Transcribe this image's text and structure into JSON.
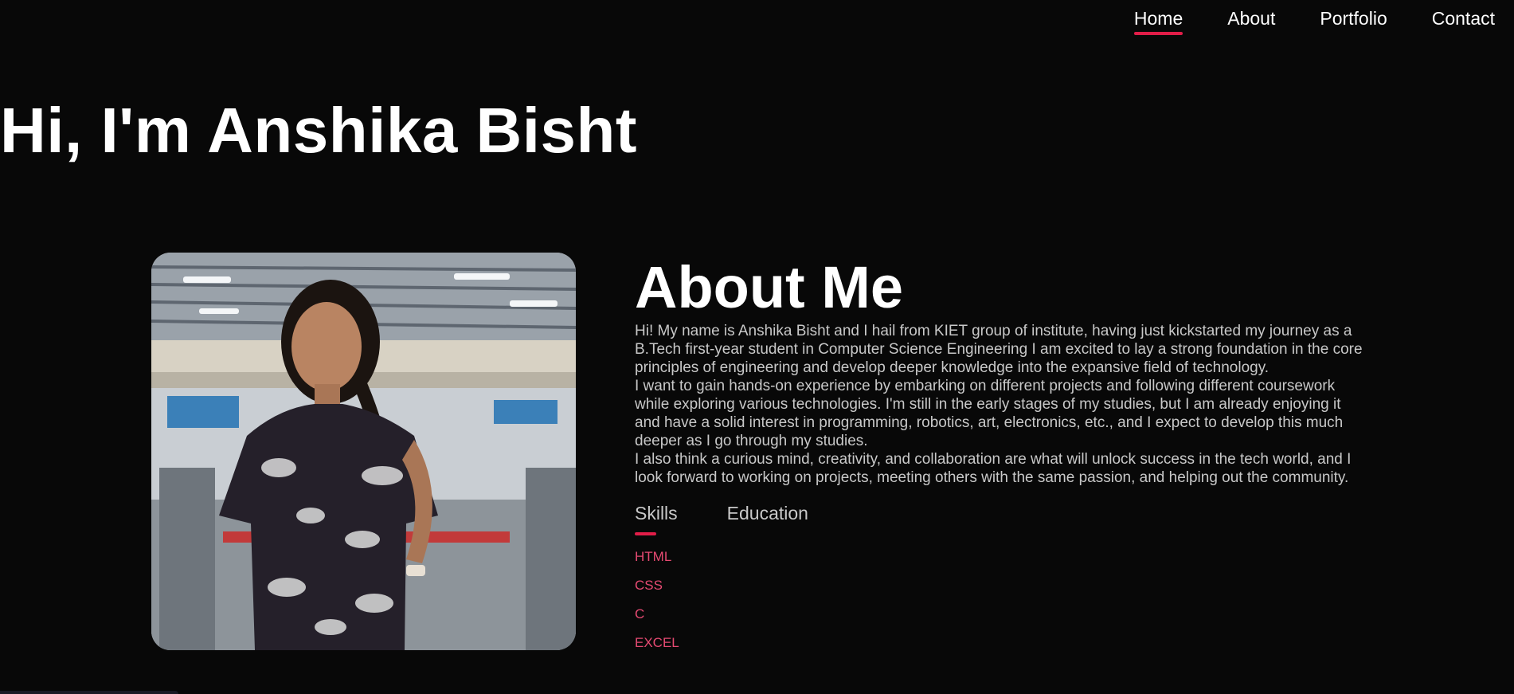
{
  "nav": {
    "items": [
      {
        "label": "Home",
        "active": true
      },
      {
        "label": "About",
        "active": false
      },
      {
        "label": "Portfolio",
        "active": false
      },
      {
        "label": "Contact",
        "active": false
      }
    ]
  },
  "hero": {
    "title": "Hi, I'm Anshika Bisht"
  },
  "about": {
    "heading": "About Me",
    "paragraphs": [
      "Hi! My name is Anshika Bisht and I hail from KIET group of institute, having just kickstarted my journey as a B.Tech first-year student in Computer Science Engineering I am excited to lay a strong foundation in the core principles of engineering and develop deeper knowledge into the expansive field of technology.",
      "I want to gain hands-on experience by embarking on different projects and following different coursework while exploring various technologies. I'm still in the early stages of my studies, but I am already enjoying it and have a solid interest in programming, robotics, art, electronics, etc., and I expect to develop this much deeper as I go through my studies.",
      "I also think a curious mind, creativity, and collaboration are what will unlock success in the tech world, and I look forward to working on projects, meeting others with the same passion, and helping out the community."
    ],
    "tabs": [
      {
        "label": "Skills",
        "active": true
      },
      {
        "label": "Education",
        "active": false
      }
    ],
    "skills": [
      "HTML",
      "CSS",
      "C",
      "EXCEL"
    ]
  },
  "colors": {
    "background": "#080808",
    "accent": "#e11d48",
    "skill_text": "#e54a72",
    "body_text": "#c8c8c8"
  }
}
